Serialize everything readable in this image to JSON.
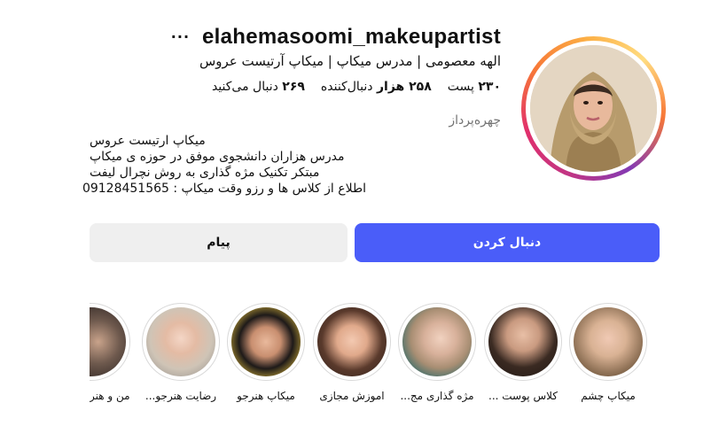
{
  "profile": {
    "username": "elahemasoomi_makeupartist",
    "more_icon": "more-horizontal-icon",
    "full_name": "الهه معصومی | مدرس میکاپ | میکاپ آرتیست عروس",
    "category": "چهره‌پرداز",
    "avatar_icon": "profile-photo"
  },
  "stats": {
    "posts_value": "۲۳۰",
    "posts_label": "پست",
    "followers_value": "۲۵۸ هزار",
    "followers_label": "دنبال‌کننده",
    "following_value": "۲۶۹",
    "following_label": "دنبال می‌کنید"
  },
  "bio": {
    "lines": [
      "میکاپ ارتیست عروس",
      "مدرس هزاران دانشجوی موفق در حوزه ی میکاپ",
      "مبتکر تکنیک مژه گذاری به روش نچرال لیفت",
      "اطلاع از کلاس ها و رزو وقت میکاپ : 09128451565"
    ]
  },
  "actions": {
    "follow_label": "دنبال کردن",
    "message_label": "پیام"
  },
  "highlights": [
    {
      "label": "میکاپ چشم"
    },
    {
      "label": "کلاس پوست ..."
    },
    {
      "label": "مژه گذاری مج..."
    },
    {
      "label": "اموزش مجازی"
    },
    {
      "label": "میکاپ هنرجو"
    },
    {
      "label": "رضایت هنرجو..."
    },
    {
      "label": "من و هنر"
    }
  ],
  "colors": {
    "follow_button": "#4a5df9",
    "message_button": "#efefef",
    "category_text": "#737373"
  }
}
